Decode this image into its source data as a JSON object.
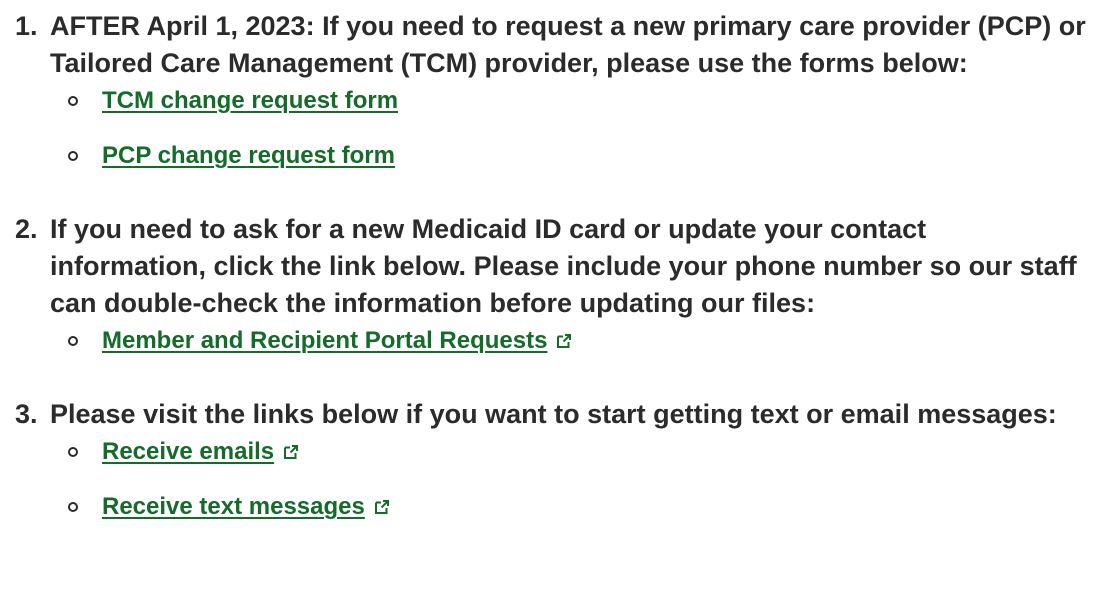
{
  "steps": [
    {
      "number": "1.",
      "text": "AFTER April 1, 2023: If you need to request a new primary care provider (PCP) or Tailored Care Management (TCM) provider, please use the forms below:",
      "links": [
        {
          "label": "TCM change request form",
          "icon": ""
        },
        {
          "label": "PCP change request form",
          "icon": ""
        }
      ]
    },
    {
      "number": "2.",
      "text": "If you need to ask for a new Medicaid ID card or update your contact information, click the link below. Please include your phone number so our staff can double-check the information before updating our files:",
      "links": [
        {
          "label": "Member and Recipient Portal Requests",
          "icon": "external-link-icon"
        }
      ]
    },
    {
      "number": "3.",
      "text": "Please visit the links below if you want to start getting text or email messages:",
      "links": [
        {
          "label": "Receive emails",
          "icon": "external-link-icon"
        },
        {
          "label": "Receive text messages",
          "icon": "external-link-icon"
        }
      ]
    }
  ],
  "colors": {
    "link": "#146b2a",
    "text": "#2b2b2b",
    "background": "#ffffff"
  }
}
